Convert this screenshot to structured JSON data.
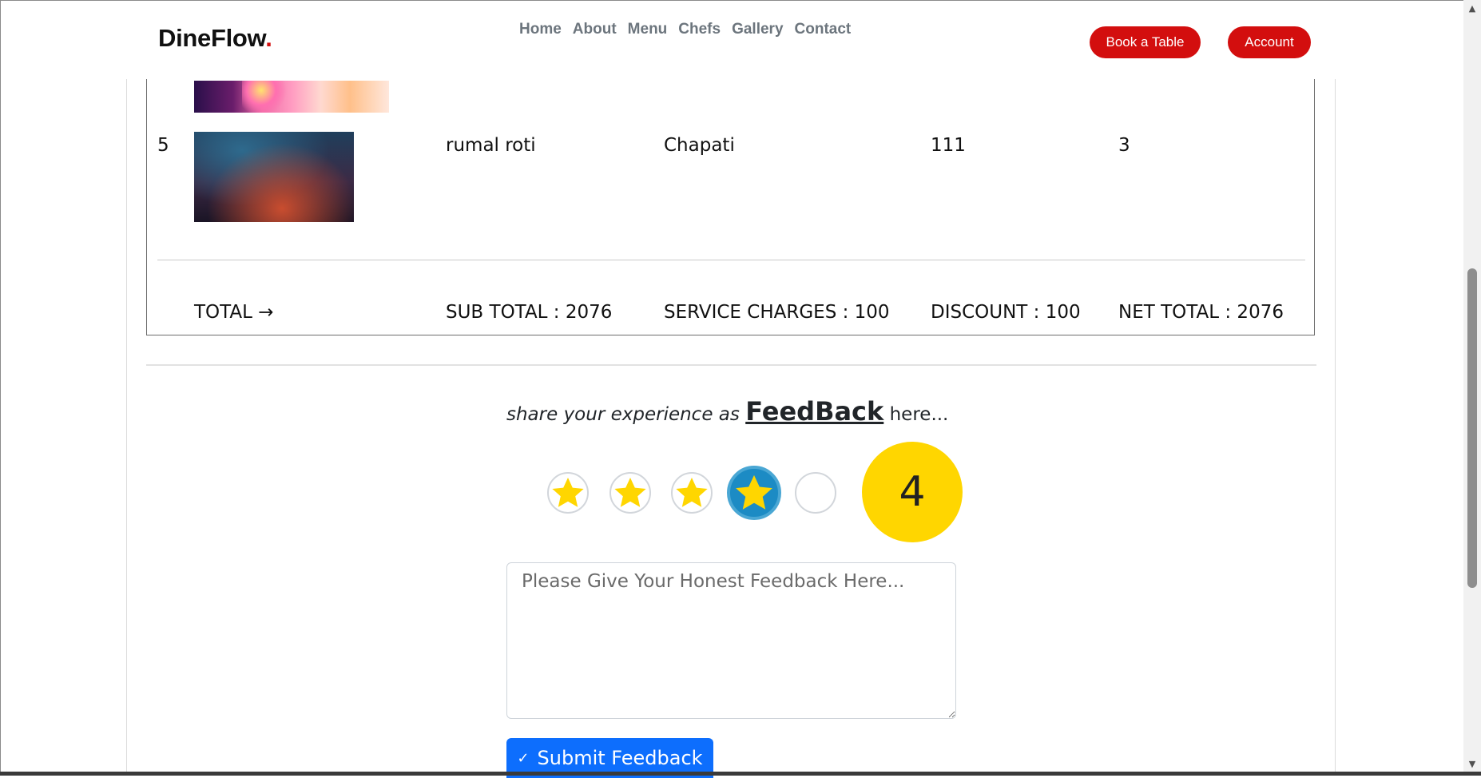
{
  "navbar": {
    "brand": "DineFlow",
    "brand_dot": ".",
    "links": [
      "Home",
      "About",
      "Menu",
      "Chefs",
      "Gallery",
      "Contact"
    ],
    "book_label": "Book a Table",
    "account_label": "Account"
  },
  "order": {
    "row": {
      "index": "5",
      "name": "rumal roti",
      "category": "Chapati",
      "price": "111",
      "quantity": "3"
    },
    "totals": {
      "label": "TOTAL →",
      "sub_total": "SUB TOTAL : 2076",
      "service_charges": "SERVICE CHARGES : 100",
      "discount": "DISCOUNT : 100",
      "net_total": "NET TOTAL : 2076"
    }
  },
  "feedback": {
    "heading_prefix": "share your experience as",
    "heading_emphasis": "FeedBack",
    "heading_suffix": "here...",
    "rating": 4,
    "max_rating": 5,
    "rating_display": "4",
    "placeholder": "Please Give Your Honest Feedback Here...",
    "submit_label": "Submit Feedback",
    "submit_icon": "check-icon"
  },
  "colors": {
    "brand_red": "#d30e0e",
    "star_yellow": "#ffd600",
    "primary_blue": "#0d6efd",
    "active_star_blue": "#1c8bc4"
  }
}
